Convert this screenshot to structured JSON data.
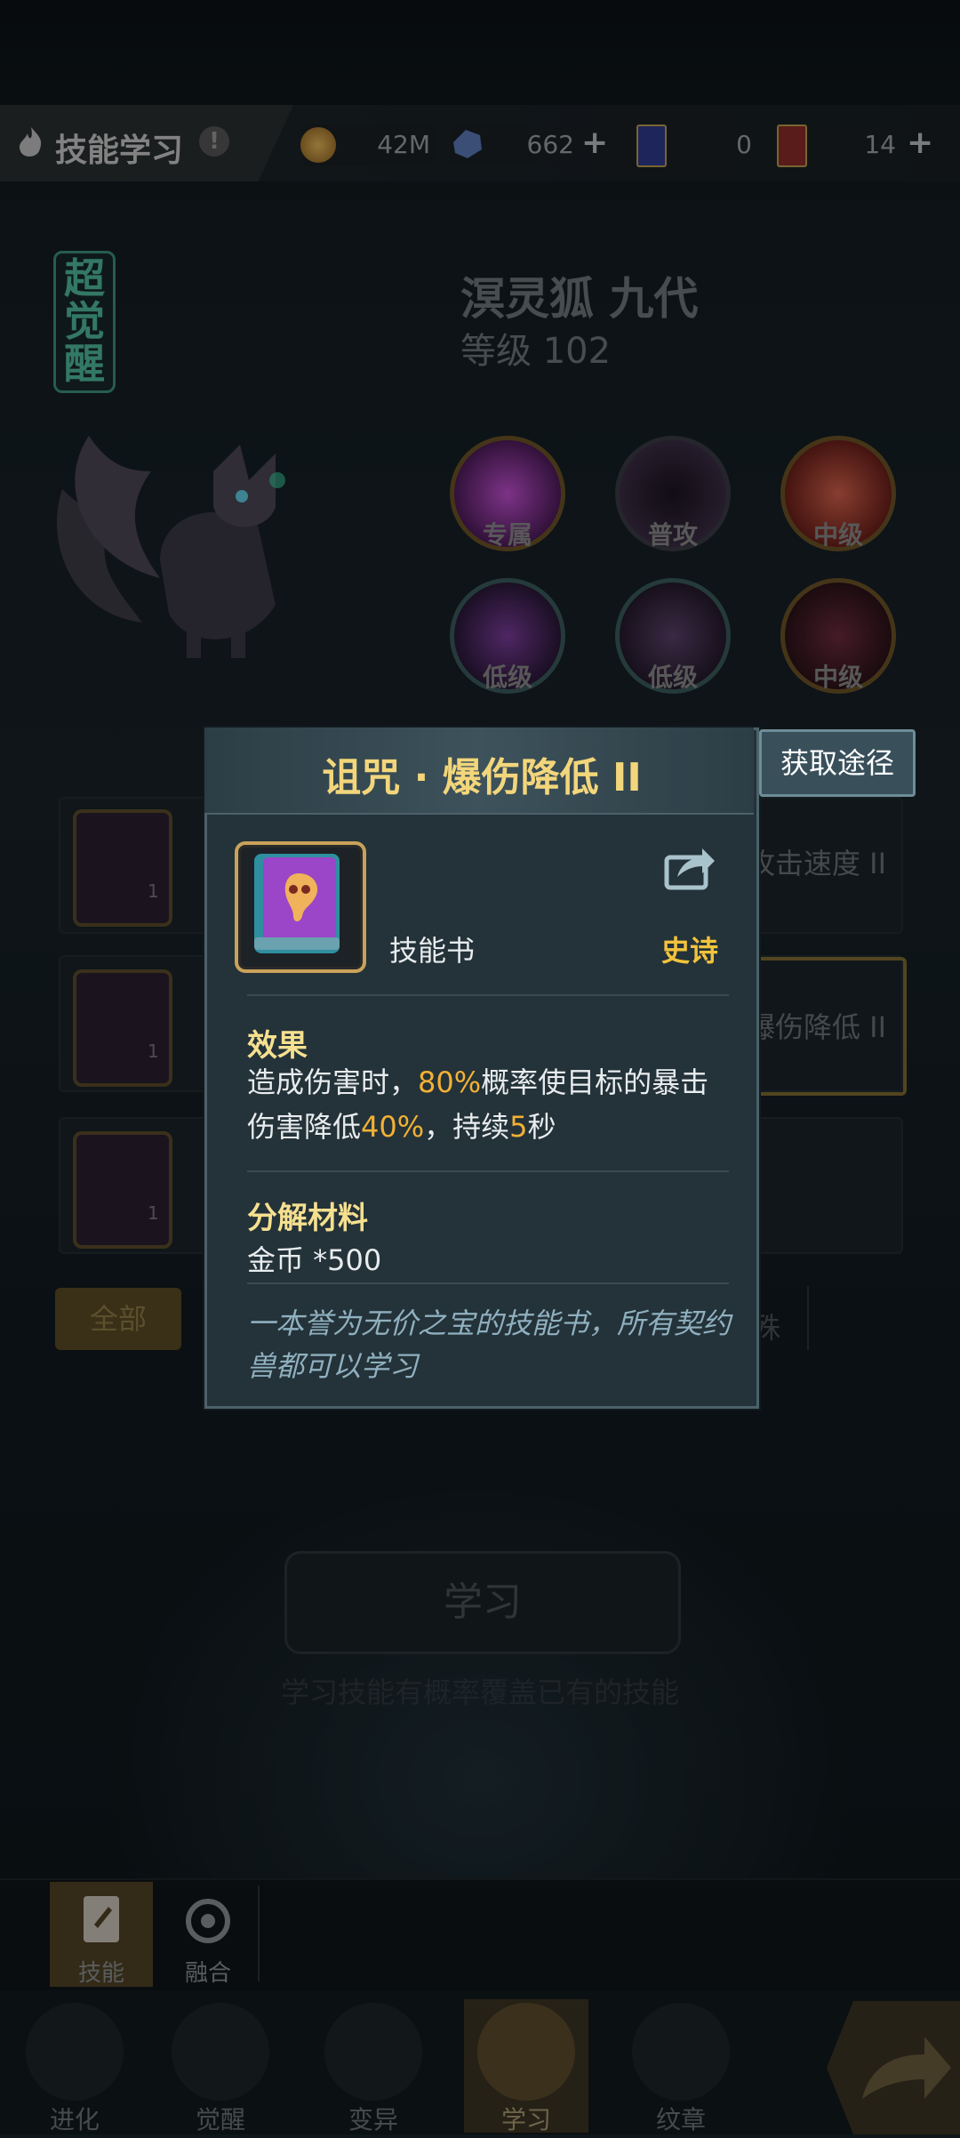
{
  "header": {
    "title": "技能学习",
    "help_icon": "!",
    "resources": [
      {
        "icon": "gold-coin-icon",
        "value": "42M",
        "has_plus": false
      },
      {
        "icon": "crystal-icon",
        "value": "662",
        "has_plus": true
      },
      {
        "icon": "blue-card-icon",
        "value": "0",
        "has_plus": false
      },
      {
        "icon": "red-card-icon",
        "value": "14",
        "has_plus": true
      }
    ]
  },
  "pet": {
    "badge": "超觉醒",
    "name": "溟灵狐 九代",
    "level": "等级 102"
  },
  "skills": [
    {
      "label": "专属",
      "color": "#b03fc0"
    },
    {
      "label": "普攻",
      "color": "#3b2c44"
    },
    {
      "label": "中级",
      "color": "#a3352c"
    },
    {
      "label": "低级",
      "color": "#5a2c70"
    },
    {
      "label": "低级",
      "color": "#3d2f4a"
    },
    {
      "label": "中级",
      "color": "#5a2a36"
    }
  ],
  "book_list": {
    "rows": [
      {
        "count": "1",
        "right_text": "攻击速度 II"
      },
      {
        "count": "1",
        "right_text": "爆伤降低 II"
      },
      {
        "count": "1",
        "right_text": ""
      }
    ],
    "filter_all": "全部",
    "filter_partial": "殊"
  },
  "learn": {
    "button": "学习",
    "hint": "学习技能有概率覆盖已有的技能"
  },
  "subtabs": [
    {
      "label": "技能",
      "icon": "skill-book-icon"
    },
    {
      "label": "融合",
      "icon": "fusion-icon"
    }
  ],
  "nav": [
    {
      "label": "进化",
      "icon": "evolve-icon"
    },
    {
      "label": "觉醒",
      "icon": "awaken-icon"
    },
    {
      "label": "变异",
      "icon": "lock-icon"
    },
    {
      "label": "学习",
      "icon": "learn-icon"
    },
    {
      "label": "纹章",
      "icon": "emblem-icon"
    }
  ],
  "popup": {
    "title": "诅咒 · 爆伤降低 II",
    "obtain_button": "获取途径",
    "item_type": "技能书",
    "rarity": "史诗",
    "effect_title": "效果",
    "effect": {
      "p1": "造成伤害时，",
      "v1": "80%",
      "p2": "概率使目标的暴击伤害降低",
      "v2": "40%",
      "p3": "，持续",
      "v3": "5",
      "p4": "秒"
    },
    "material_title": "分解材料",
    "material": "金币 *500",
    "flavor": "一本誉为无价之宝的技能书，所有契约兽都可以学习"
  },
  "colors": {
    "accent_gold": "#f2c33c",
    "highlight": "#f2b134",
    "title_gold": "#f3d67b"
  }
}
